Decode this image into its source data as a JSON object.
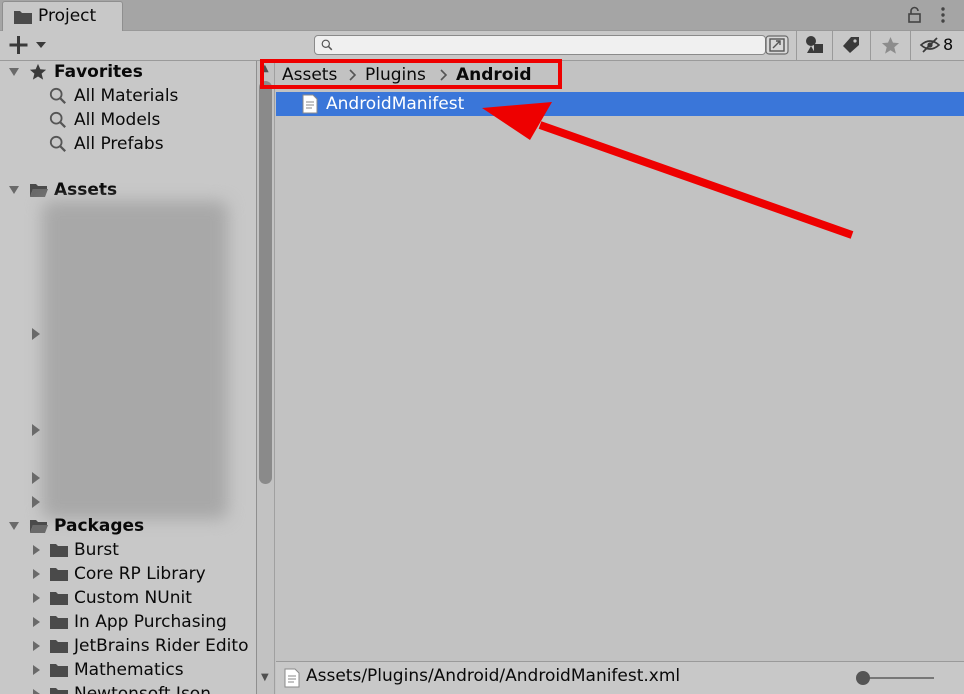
{
  "window": {
    "tab_label": "Project",
    "hidden_count": "8"
  },
  "search": {
    "value": "",
    "placeholder": ""
  },
  "favorites": {
    "label": "Favorites",
    "items": [
      {
        "label": "All Materials",
        "icon": "search-icon"
      },
      {
        "label": "All Models",
        "icon": "search-icon"
      },
      {
        "label": "All Prefabs",
        "icon": "search-icon"
      }
    ]
  },
  "assets": {
    "label": "Assets"
  },
  "packages": {
    "label": "Packages",
    "items": [
      {
        "label": "Burst",
        "icon": "folder-icon"
      },
      {
        "label": "Core RP Library",
        "icon": "folder-icon"
      },
      {
        "label": "Custom NUnit",
        "icon": "folder-icon"
      },
      {
        "label": "In App Purchasing",
        "icon": "folder-icon"
      },
      {
        "label": "JetBrains Rider Edito",
        "icon": "folder-icon"
      },
      {
        "label": "Mathematics",
        "icon": "folder-icon"
      },
      {
        "label": "Newtonsoft Json",
        "icon": "folder-icon"
      }
    ]
  },
  "breadcrumb": {
    "items": [
      "Assets",
      "Plugins",
      "Android"
    ]
  },
  "files": [
    {
      "label": "AndroidManifest",
      "icon": "text-file-icon",
      "selected": true
    }
  ],
  "status": {
    "path": "Assets/Plugins/Android/AndroidManifest.xml"
  },
  "zoom": {
    "level": 0
  },
  "colors": {
    "selection": "#3a76d9",
    "highlight": "#ee0000",
    "panel": "#c8c8c8"
  }
}
